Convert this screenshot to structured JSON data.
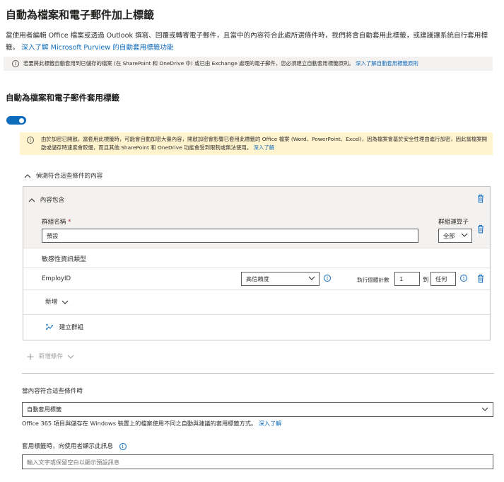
{
  "page_title": "自動為檔案和電子郵件加上標籤",
  "description": {
    "text": "當使用者編輯 Office 檔案或透過 Outlook 撰寫、回覆或轉寄電子郵件，且當中的內容符合此處所選條件時，我們將會自動套用此標籤，或建議讓系統自行套用標籤。",
    "link": "深入了解 Microsoft Purview 的自動套用標籤功能"
  },
  "info_bar": {
    "text": "若要將此標籤自動套用到已儲存的檔案 (在 SharePoint 和 OneDrive 中) 或已由 Exchange 處理的電子郵件，您必須建立自動套用標籤原則。",
    "link": "深入了解自動套用標籤原則"
  },
  "section_title": "自動為檔案和電子郵件套用標籤",
  "toggle": {
    "on": true
  },
  "warning": {
    "text": "由於加密已開啟，當套用此標籤時，可能會自動加密大量內容，開啟加密會影響已套用此標籤的 Office 檔案 (Word、PowerPoint、Excel)，因為檔案會基於安全性理由進行加密，因此當檔案開啟或儲存時速度會較慢，而且其他 SharePoint 和 OneDrive 功能會受到限制或無法使用。",
    "link": "深入了解"
  },
  "detect_toggle_label": "偵測符合這些條件的內容",
  "content_contains_label": "內容包含",
  "group": {
    "name_label": "群組名稱",
    "name_value": "預設",
    "operator_label": "群組運算子",
    "operator_value": "全部"
  },
  "sensitive_types_header": "敏感性資訊類型",
  "sit_row": {
    "name": "EmployID",
    "confidence": "高信賴度",
    "instance_label": "執行個體計數",
    "min": "1",
    "to_label": "到",
    "max": "任何"
  },
  "add_label": "新增",
  "create_group_label": "建立群組",
  "add_condition_label": "新增條件",
  "when_match_label": "當內容符合這些條件時",
  "action_value": "自動套用標籤",
  "action_note": {
    "text": "Office 365 項目與儲存在 Windows 裝置上的檔案使用不同之自動與建議的套用標籤方式。",
    "link": "深入了解"
  },
  "message_label": "套用標籤時，向使用者顯示此訊息",
  "message_placeholder": "輸入文字或保留空白以顯示預設訊息",
  "colors": {
    "accent": "#0f6cbd",
    "warning_bg": "#fff4ce",
    "info_bg": "#f3f2f1"
  },
  "icons": [
    "info-icon",
    "chevron-up-icon",
    "chevron-down-icon",
    "trash-icon",
    "create-group-icon",
    "plus-icon"
  ]
}
